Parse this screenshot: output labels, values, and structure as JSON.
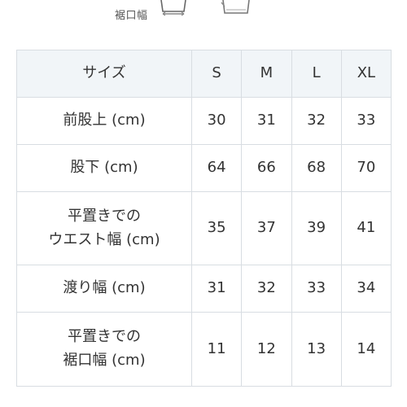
{
  "diagram": {
    "hem_label": "裾口幅"
  },
  "table": {
    "header": {
      "label": "サイズ",
      "sizes": [
        "S",
        "M",
        "L",
        "XL"
      ]
    },
    "rows": [
      {
        "label_lines": [
          "前股上 (cm)"
        ],
        "values": [
          "30",
          "31",
          "32",
          "33"
        ]
      },
      {
        "label_lines": [
          "股下 (cm)"
        ],
        "values": [
          "64",
          "66",
          "68",
          "70"
        ]
      },
      {
        "label_lines": [
          "平置きでの",
          "ウエスト幅 (cm)"
        ],
        "values": [
          "35",
          "37",
          "39",
          "41"
        ]
      },
      {
        "label_lines": [
          "渡り幅 (cm)"
        ],
        "values": [
          "31",
          "32",
          "33",
          "34"
        ]
      },
      {
        "label_lines": [
          "平置きでの",
          "裾口幅 (cm)"
        ],
        "values": [
          "11",
          "12",
          "13",
          "14"
        ]
      }
    ]
  }
}
